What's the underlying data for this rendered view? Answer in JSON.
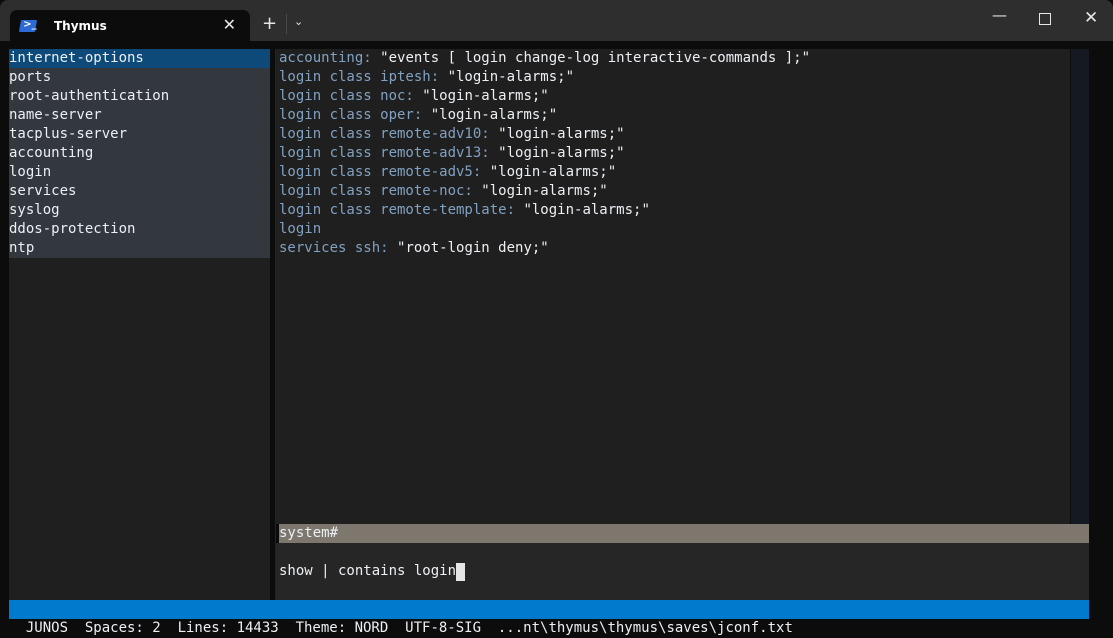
{
  "window": {
    "tab_title": "Thymus",
    "tab_icon": "powershell-icon",
    "close_tab_glyph": "✕",
    "new_tab_glyph": "+",
    "dropdown_glyph": "⌄",
    "minimize_glyph": "—",
    "close_glyph": "✕"
  },
  "sidebar": {
    "items": [
      {
        "label": "internet-options",
        "selected": true
      },
      {
        "label": "ports"
      },
      {
        "label": "root-authentication"
      },
      {
        "label": "name-server"
      },
      {
        "label": "tacplus-server"
      },
      {
        "label": "accounting"
      },
      {
        "label": "login"
      },
      {
        "label": "services"
      },
      {
        "label": "syslog"
      },
      {
        "label": "ddos-protection"
      },
      {
        "label": "ntp"
      }
    ]
  },
  "output": {
    "lines": [
      {
        "key": "accounting: ",
        "value": "\"events [ login change-log interactive-commands ];\""
      },
      {
        "key": "login class iptesh: ",
        "value": "\"login-alarms;\""
      },
      {
        "key": "login class noc: ",
        "value": "\"login-alarms;\""
      },
      {
        "key": "login class oper: ",
        "value": "\"login-alarms;\""
      },
      {
        "key": "login class remote-adv10: ",
        "value": "\"login-alarms;\""
      },
      {
        "key": "login class remote-adv13: ",
        "value": "\"login-alarms;\""
      },
      {
        "key": "login class remote-adv5: ",
        "value": "\"login-alarms;\""
      },
      {
        "key": "login class remote-noc: ",
        "value": "\"login-alarms;\""
      },
      {
        "key": "login class remote-template: ",
        "value": "\"login-alarms;\""
      },
      {
        "key": "login",
        "value": ""
      },
      {
        "key": "services ssh: ",
        "value": "\"root-login deny;\""
      }
    ]
  },
  "prompt": {
    "context": "system#",
    "input_value": "show | contains login"
  },
  "statusbar": {
    "text": "JUNOS  Spaces: 2  Lines: 14433  Theme: NORD  UTF-8-SIG  ...nt\\thymus\\thymus\\saves\\jconf.txt",
    "mode": "JUNOS",
    "spaces": "2",
    "lines": "14433",
    "theme": "NORD",
    "encoding": "UTF-8-SIG",
    "path": "...nt\\thymus\\thymus\\saves\\jconf.txt"
  },
  "colors": {
    "selection": "#0e4a79",
    "key": "#81a1c1",
    "value": "#eceff4",
    "statusbar": "#007acc",
    "prompt_bar": "#7d776e"
  }
}
